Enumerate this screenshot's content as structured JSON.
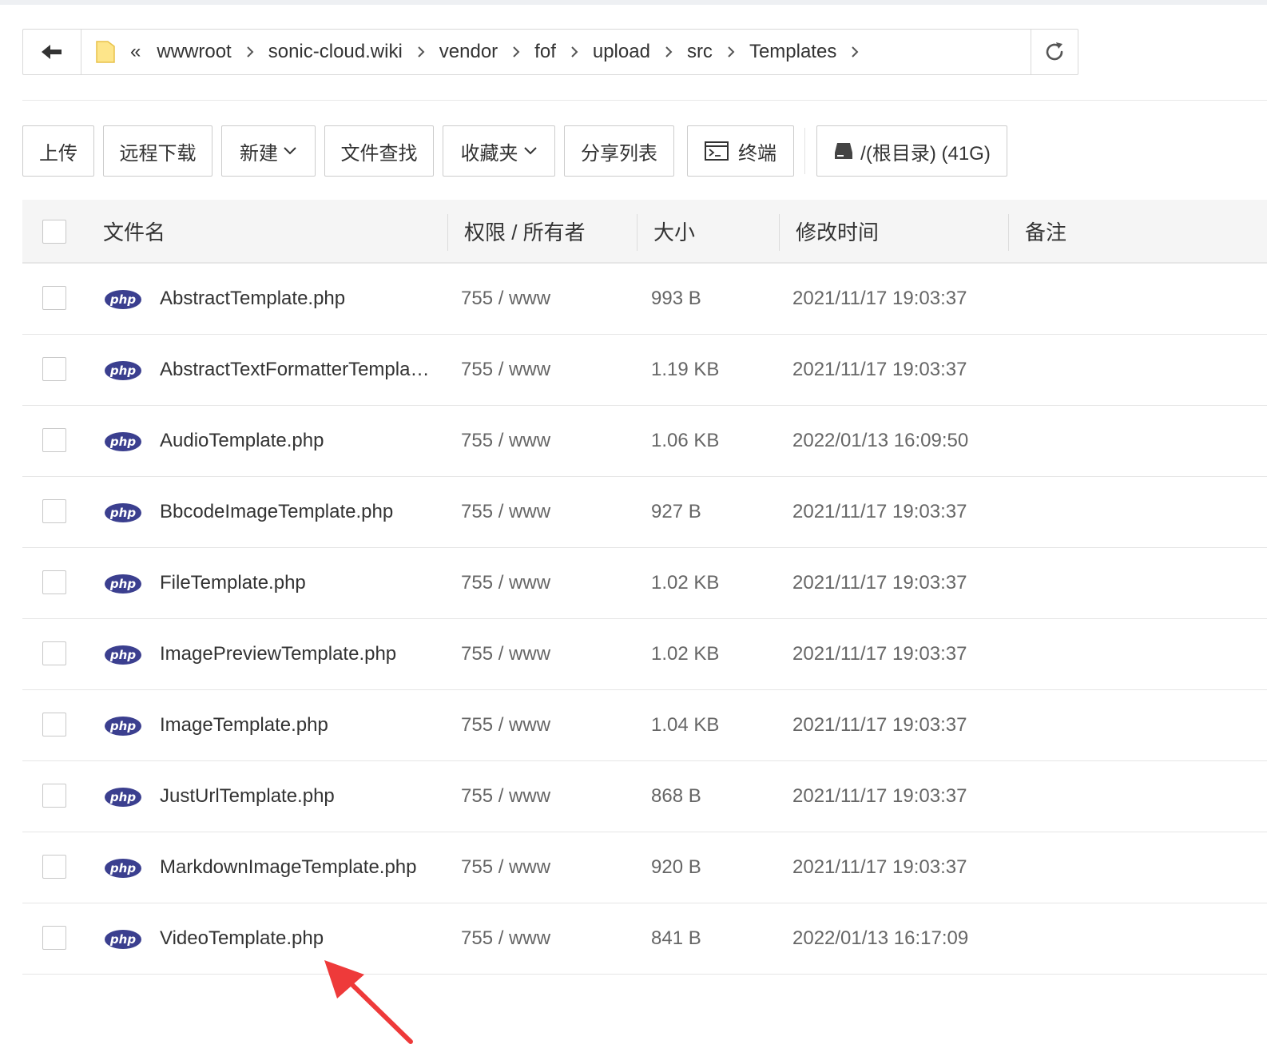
{
  "path": {
    "back_icon": "arrow-left-icon",
    "folder_icon": "folder-icon",
    "collapse_label": "«",
    "crumbs": [
      "wwwroot",
      "sonic-cloud.wiki",
      "vendor",
      "fof",
      "upload",
      "src",
      "Templates"
    ],
    "refresh_icon": "refresh-icon"
  },
  "toolbar": {
    "upload": "上传",
    "remote_download": "远程下载",
    "new": "新建",
    "find_files": "文件查找",
    "favorites": "收藏夹",
    "share_list": "分享列表",
    "terminal": "终端",
    "disk": "/(根目录) (41G)"
  },
  "table": {
    "headers": {
      "name": "文件名",
      "perm": "权限 / 所有者",
      "size": "大小",
      "mtime": "修改时间",
      "note": "备注"
    },
    "icon_label": "php",
    "rows": [
      {
        "name": "AbstractTemplate.php",
        "perm": "755 / www",
        "size": "993 B",
        "mtime": "2021/11/17 19:03:37"
      },
      {
        "name": "AbstractTextFormatterTemplat…",
        "perm": "755 / www",
        "size": "1.19 KB",
        "mtime": "2021/11/17 19:03:37"
      },
      {
        "name": "AudioTemplate.php",
        "perm": "755 / www",
        "size": "1.06 KB",
        "mtime": "2022/01/13 16:09:50"
      },
      {
        "name": "BbcodeImageTemplate.php",
        "perm": "755 / www",
        "size": "927 B",
        "mtime": "2021/11/17 19:03:37"
      },
      {
        "name": "FileTemplate.php",
        "perm": "755 / www",
        "size": "1.02 KB",
        "mtime": "2021/11/17 19:03:37"
      },
      {
        "name": "ImagePreviewTemplate.php",
        "perm": "755 / www",
        "size": "1.02 KB",
        "mtime": "2021/11/17 19:03:37"
      },
      {
        "name": "ImageTemplate.php",
        "perm": "755 / www",
        "size": "1.04 KB",
        "mtime": "2021/11/17 19:03:37"
      },
      {
        "name": "JustUrlTemplate.php",
        "perm": "755 / www",
        "size": "868 B",
        "mtime": "2021/11/17 19:03:37"
      },
      {
        "name": "MarkdownImageTemplate.php",
        "perm": "755 / www",
        "size": "920 B",
        "mtime": "2021/11/17 19:03:37"
      },
      {
        "name": "VideoTemplate.php",
        "perm": "755 / www",
        "size": "841 B",
        "mtime": "2022/01/13 16:17:09"
      }
    ]
  },
  "colors": {
    "php_badge": "#3b3f8f",
    "annotation_arrow": "#ee3a3a"
  }
}
